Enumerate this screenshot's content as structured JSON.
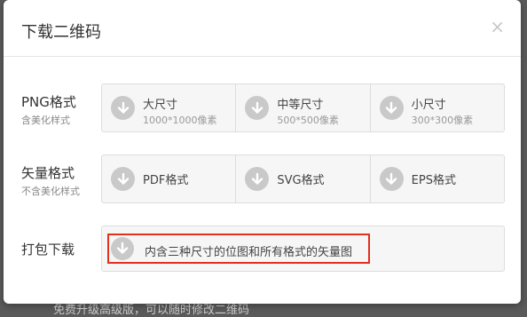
{
  "backdrop": {
    "text": "免费升级高级版，可以随时修改二维码"
  },
  "dialog": {
    "title": "下载二维码",
    "close": "×"
  },
  "png": {
    "label": "PNG格式",
    "sublabel": "含美化样式",
    "options": [
      {
        "name": "大尺寸",
        "size": "1000*1000像素"
      },
      {
        "name": "中等尺寸",
        "size": "500*500像素"
      },
      {
        "name": "小尺寸",
        "size": "300*300像素"
      }
    ]
  },
  "vector": {
    "label": "矢量格式",
    "sublabel": "不含美化样式",
    "options": [
      {
        "name": "PDF格式"
      },
      {
        "name": "SVG格式"
      },
      {
        "name": "EPS格式"
      }
    ]
  },
  "bundle": {
    "label": "打包下载",
    "text": "内含三种尺寸的位图和所有格式的矢量图"
  },
  "icons": {
    "download": "download-circle-icon",
    "close": "close-icon"
  },
  "colors": {
    "highlight": "#e0301e",
    "icon": "#c9c9c9"
  }
}
